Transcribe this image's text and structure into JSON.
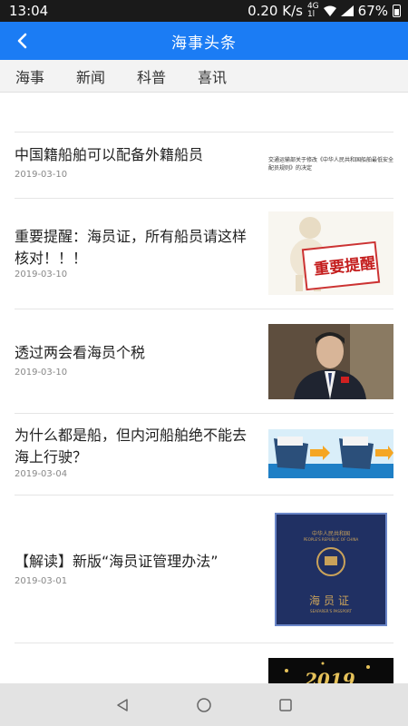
{
  "status_bar": {
    "time": "13:04",
    "speed": "0.20 K/s",
    "network_top": "4G",
    "network_bottom": "1l",
    "battery": "67%"
  },
  "app_bar": {
    "title": "海事头条",
    "back_icon": "chevron-left-icon"
  },
  "tabs": [
    {
      "label": "海事"
    },
    {
      "label": "新闻"
    },
    {
      "label": "科普"
    },
    {
      "label": "喜讯"
    }
  ],
  "news": [
    {
      "title": "中国籍船舶可以配备外籍船员",
      "date": "2019-03-10",
      "thumb_caption": "交通运输部关于修改《中华人民共和国船舶最低安全配员规则》的决定"
    },
    {
      "title": "重要提醒：海员证，所有船员请这样核对！！！",
      "date": "2019-03-10",
      "thumb_caption": "重要提醒"
    },
    {
      "title": "透过两会看海员个税",
      "date": "2019-03-10"
    },
    {
      "title": "为什么都是船，但内河船舶绝不能去海上行驶？",
      "date": "2019-03-04"
    },
    {
      "title": "【解读】新版“海员证管理办法”",
      "date": "2019-03-01",
      "thumb_caption": {
        "country": "中华人民共和国",
        "country_en": "PEOPLE'S REPUBLIC OF CHINA",
        "doc": "海员证",
        "doc_en": "SEAFARER'S PASSPORT"
      }
    },
    {
      "title": "",
      "date": "",
      "thumb_caption": "2019"
    }
  ],
  "colors": {
    "accent": "#1b7cf4",
    "status_bar": "#1a1a1a",
    "tab_bg": "#f3f3f3",
    "nav_bg": "#e3e3e3"
  }
}
